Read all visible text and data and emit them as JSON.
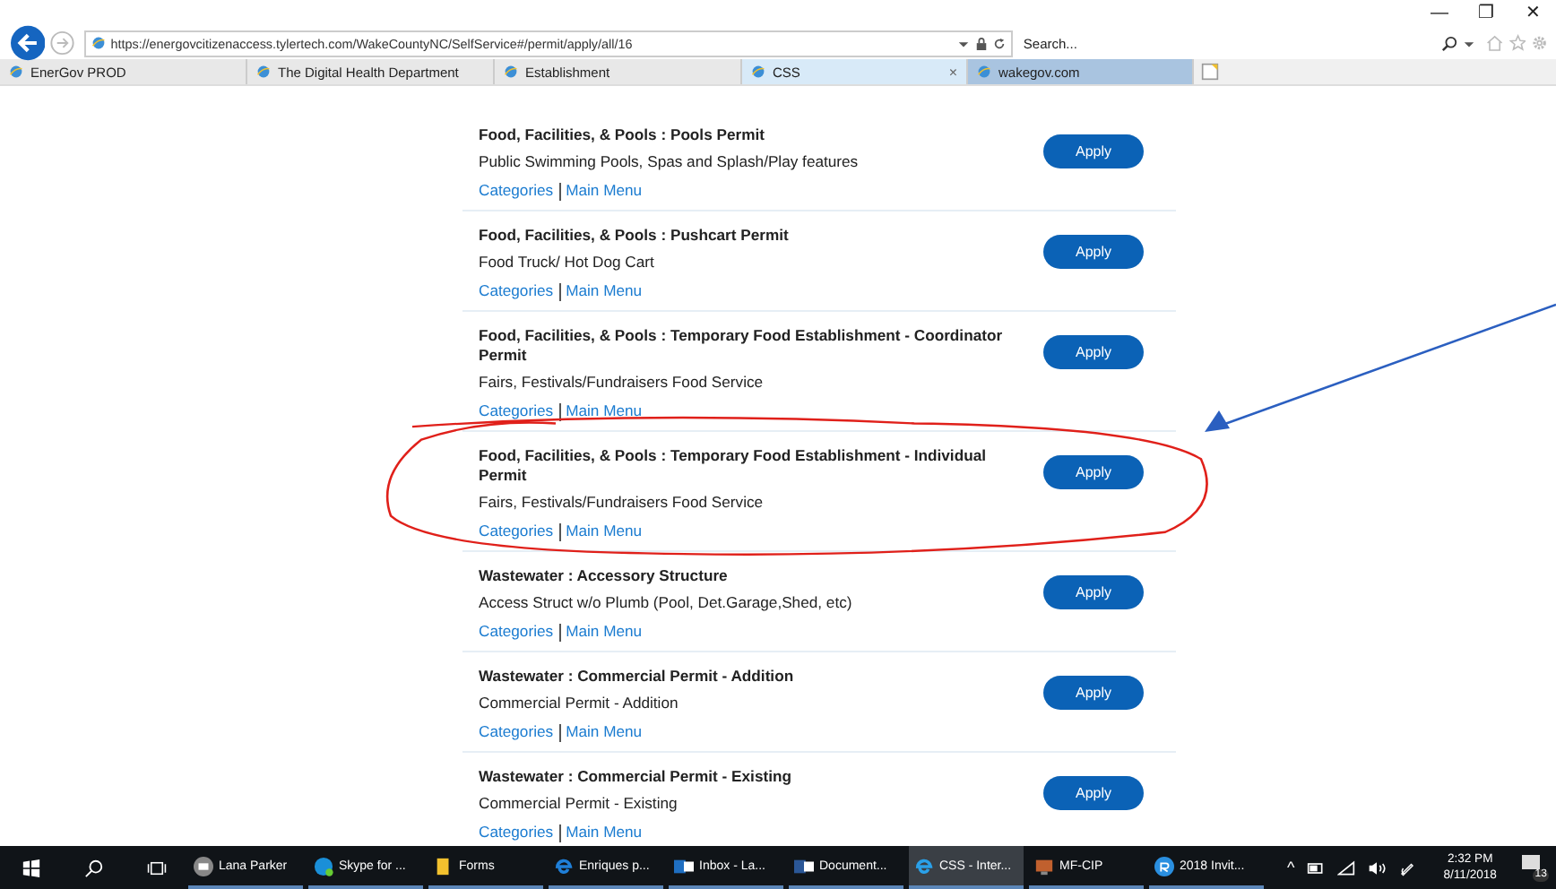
{
  "window": {
    "controls": [
      "—",
      "❐",
      "✕"
    ]
  },
  "address_bar": {
    "url": "https://energovcitizenaccess.tylertech.com/WakeCountyNC/SelfService#/permit/apply/all/16"
  },
  "search": {
    "placeholder": "Search..."
  },
  "tabs": [
    {
      "label": "EnerGov PROD",
      "selected": false,
      "closable": false
    },
    {
      "label": "The Digital Health Department",
      "selected": false,
      "closable": false
    },
    {
      "label": "Establishment",
      "selected": false,
      "closable": false
    },
    {
      "label": "CSS",
      "selected": true,
      "closable": true
    },
    {
      "label": "wakegov.com",
      "selected": false,
      "closable": false
    }
  ],
  "tab_close": "×",
  "permits": [
    {
      "title": "Food, Facilities, & Pools : Pools Permit",
      "description": "Public Swimming Pools, Spas and Splash/Play features",
      "links": [
        "Categories",
        "Main Menu"
      ],
      "button": "Apply",
      "circled": false
    },
    {
      "title": "Food, Facilities, & Pools : Pushcart Permit",
      "description": "Food Truck/ Hot Dog Cart",
      "links": [
        "Categories",
        "Main Menu"
      ],
      "button": "Apply",
      "circled": false
    },
    {
      "title": "Food, Facilities, & Pools : Temporary Food Establishment - Coordinator Permit",
      "description": "Fairs, Festivals/Fundraisers Food Service",
      "links": [
        "Categories",
        "Main Menu"
      ],
      "button": "Apply",
      "circled": false
    },
    {
      "title": "Food, Facilities, & Pools : Temporary Food Establishment - Individual Permit",
      "description": "Fairs, Festivals/Fundraisers Food Service",
      "links": [
        "Categories",
        "Main Menu"
      ],
      "button": "Apply",
      "circled": true
    },
    {
      "title": "Wastewater : Accessory Structure",
      "description": "Access Struct w/o Plumb (Pool, Det.Garage,Shed, etc)",
      "links": [
        "Categories",
        "Main Menu"
      ],
      "button": "Apply",
      "circled": false
    },
    {
      "title": "Wastewater : Commercial Permit - Addition",
      "description": "Commercial Permit - Addition",
      "links": [
        "Categories",
        "Main Menu"
      ],
      "button": "Apply",
      "circled": false
    },
    {
      "title": "Wastewater : Commercial Permit - Existing",
      "description": "Commercial Permit - Existing",
      "links": [
        "Categories",
        "Main Menu"
      ],
      "button": "Apply",
      "circled": false
    }
  ],
  "taskbar": {
    "apps": [
      {
        "label": "Lana Parker",
        "kind": "chat",
        "selected": false
      },
      {
        "label": "Skype for ...",
        "kind": "skype",
        "selected": false
      },
      {
        "label": "Forms",
        "kind": "folder",
        "selected": false
      },
      {
        "label": "Enriques p...",
        "kind": "edge",
        "selected": false
      },
      {
        "label": "Inbox - La...",
        "kind": "outlook",
        "selected": false
      },
      {
        "label": "Document...",
        "kind": "word",
        "selected": false
      },
      {
        "label": "CSS - Inter...",
        "kind": "ie",
        "selected": true
      },
      {
        "label": "MF-CIP",
        "kind": "monitor",
        "selected": false
      },
      {
        "label": "2018 Invit...",
        "kind": "remote",
        "selected": false
      }
    ],
    "tray": {
      "chevron": "^",
      "time": "2:32 PM",
      "date": "8/11/2018",
      "notifications": "13"
    }
  }
}
